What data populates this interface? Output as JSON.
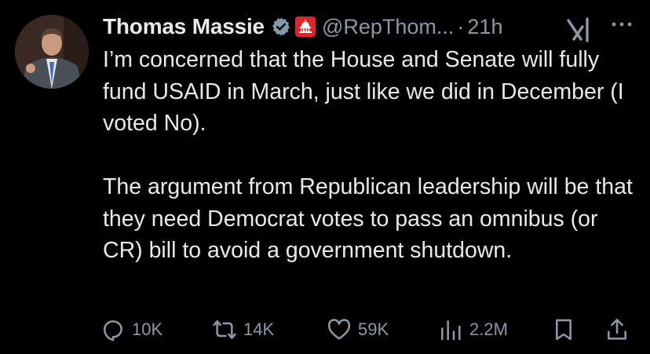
{
  "author": {
    "display_name": "Thomas Massie",
    "handle": "@RepThom...",
    "separator": "·",
    "time": "21h",
    "avatar_icon": "profile-photo",
    "verified_icon": "verified-badge-icon",
    "affiliation_icon": "capitol-affiliation-icon"
  },
  "tweet": {
    "paragraphs": [
      "I’m concerned that the House and Senate will fully fund USAID in March, just like we did in December (I voted No).",
      "The argument from Republican leadership will be that they need Democrat votes to pass an omnibus (or CR) bill to avoid a government shutdown."
    ]
  },
  "actions": {
    "replies": "10K",
    "retweets": "14K",
    "likes": "59K",
    "views": "2.2M"
  },
  "colors": {
    "background": "#000000",
    "text": "#e7e9ea",
    "secondary": "#8b98a5",
    "affiliation_badge": "#e0242c"
  }
}
